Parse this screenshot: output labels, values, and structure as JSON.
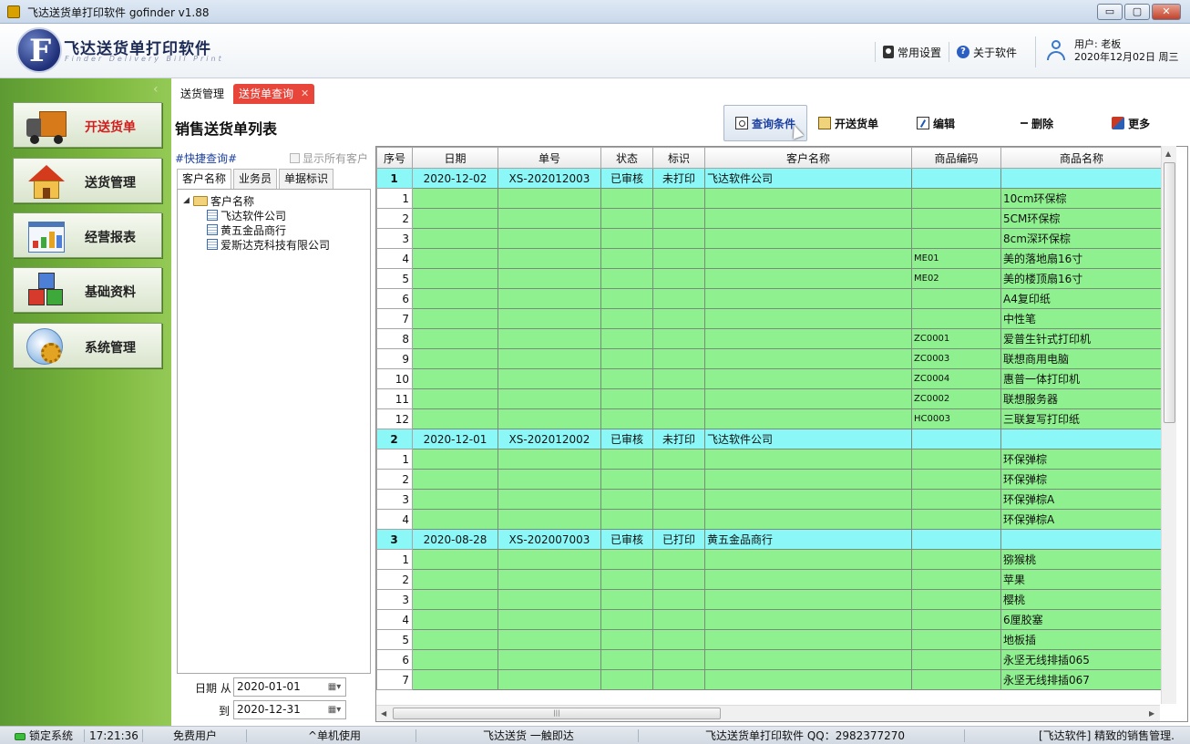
{
  "window": {
    "title": "飞达送货单打印软件  gofinder v1.88",
    "buttons": {
      "minimize": "▭",
      "maximize": "▢",
      "close": "✕"
    }
  },
  "header": {
    "brand_cn": "飞达送货单打印软件",
    "brand_en": "Finder Delivery Bill Print",
    "links": [
      {
        "label": "常用设置",
        "icon": "settings-icon"
      },
      {
        "label": "关于软件",
        "icon": "about-icon"
      }
    ],
    "user_label": "用户: 老板",
    "user_date": "2020年12月02日 周三"
  },
  "sidebar": {
    "collapse": "‹",
    "items": [
      {
        "label": "开送货单",
        "icon": "truck-icon",
        "active": true
      },
      {
        "label": "送货管理",
        "icon": "house-icon"
      },
      {
        "label": "经营报表",
        "icon": "report-chart-icon"
      },
      {
        "label": "基础资料",
        "icon": "cubes-icon"
      },
      {
        "label": "系统管理",
        "icon": "gear-icon"
      }
    ]
  },
  "tabs": [
    {
      "label": "送货管理"
    },
    {
      "label": "送货单查询",
      "close": "✕",
      "active": true
    }
  ],
  "page_title": "销售送货单列表",
  "toolbar": {
    "query": "查询条件",
    "new": "开送货单",
    "edit": "编辑",
    "delete": "删除",
    "more": "更多"
  },
  "query_panel": {
    "quick_label": "#快捷查询#",
    "show_all": "显示所有客户",
    "tabs": [
      "客户名称",
      "业务员",
      "单据标识"
    ],
    "tree_root": "客户名称",
    "customers": [
      "飞达软件公司",
      "黄五金品商行",
      "爱斯达克科技有限公司"
    ],
    "date_from_label": "日期 从",
    "date_from": "2020-01-01",
    "date_to_label": "到",
    "date_to": "2020-12-31"
  },
  "grid": {
    "columns": [
      "序号",
      "日期",
      "单号",
      "状态",
      "标识",
      "客户名称",
      "商品编码",
      "商品名称"
    ],
    "orders": [
      {
        "no": "1",
        "date": "2020-12-02",
        "number": "XS-202012003",
        "status": "已审核",
        "flag": "未打印",
        "customer": "飞达软件公司",
        "items": [
          {
            "n": "1",
            "code": "",
            "name": "10cm环保棕"
          },
          {
            "n": "2",
            "code": "",
            "name": "5CM环保棕"
          },
          {
            "n": "3",
            "code": "",
            "name": "8cm深环保棕"
          },
          {
            "n": "4",
            "code": "ME01",
            "name": "美的落地扇16寸"
          },
          {
            "n": "5",
            "code": "ME02",
            "name": "美的楼顶扇16寸"
          },
          {
            "n": "6",
            "code": "",
            "name": "A4复印纸"
          },
          {
            "n": "7",
            "code": "",
            "name": "中性笔"
          },
          {
            "n": "8",
            "code": "ZC0001",
            "name": "爱普生针式打印机"
          },
          {
            "n": "9",
            "code": "ZC0003",
            "name": "联想商用电脑"
          },
          {
            "n": "10",
            "code": "ZC0004",
            "name": "惠普一体打印机"
          },
          {
            "n": "11",
            "code": "ZC0002",
            "name": "联想服务器"
          },
          {
            "n": "12",
            "code": "HC0003",
            "name": "三联复写打印纸"
          }
        ]
      },
      {
        "no": "2",
        "date": "2020-12-01",
        "number": "XS-202012002",
        "status": "已审核",
        "flag": "未打印",
        "customer": "飞达软件公司",
        "items": [
          {
            "n": "1",
            "code": "",
            "name": "环保弹棕"
          },
          {
            "n": "2",
            "code": "",
            "name": "环保弹棕"
          },
          {
            "n": "3",
            "code": "",
            "name": "环保弹棕A"
          },
          {
            "n": "4",
            "code": "",
            "name": "环保弹棕A"
          }
        ]
      },
      {
        "no": "3",
        "date": "2020-08-28",
        "number": "XS-202007003",
        "status": "已审核",
        "flag": "已打印",
        "customer": "黄五金品商行",
        "items": [
          {
            "n": "1",
            "code": "",
            "name": "猕猴桃"
          },
          {
            "n": "2",
            "code": "",
            "name": "苹果"
          },
          {
            "n": "3",
            "code": "",
            "name": "樱桃"
          },
          {
            "n": "4",
            "code": "",
            "name": "6厘胶塞"
          },
          {
            "n": "5",
            "code": "",
            "name": "地板插"
          },
          {
            "n": "6",
            "code": "",
            "name": "永坚无线排插065"
          },
          {
            "n": "7",
            "code": "",
            "name": "永坚无线排插067"
          }
        ]
      }
    ]
  },
  "statusbar": {
    "lock": "锁定系统",
    "time": "17:21:36",
    "user_type": "免费用户",
    "mode": "^单机使用",
    "slogan": "飞达送货 一触即达",
    "qq": "飞达送货单打印软件 QQ：2982377270",
    "ad": "[飞达软件] 精致的销售管理..."
  },
  "colors": {
    "sidebar_green": "#7db83e",
    "order_row": "#8cf7f7",
    "item_row": "#8ff08f",
    "active_tab": "#e8463b",
    "active_nav_text": "#d21d1d"
  }
}
